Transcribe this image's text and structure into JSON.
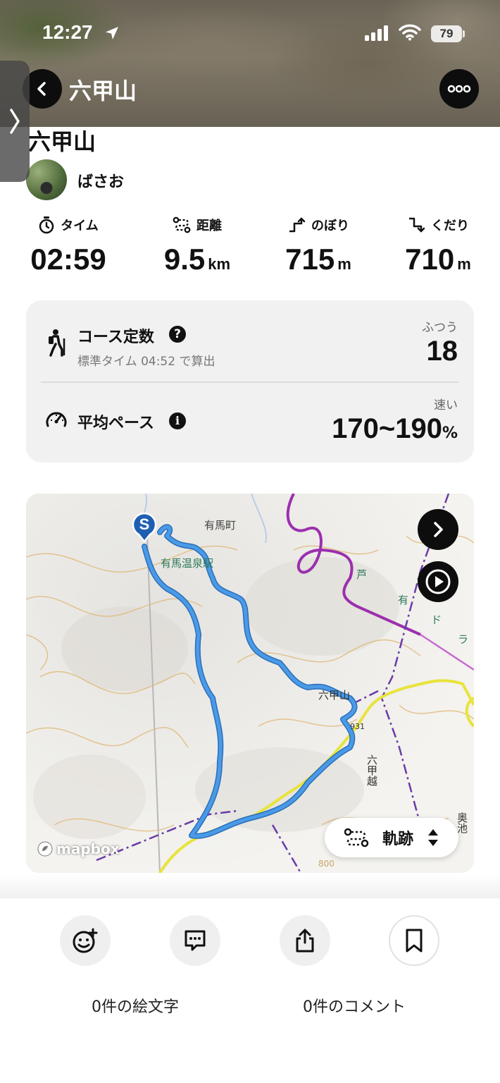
{
  "status_bar": {
    "time": "12:27",
    "battery": "79"
  },
  "nav": {
    "title": "六甲山"
  },
  "activity": {
    "title": "六甲山",
    "user": "ばさお",
    "stats": [
      {
        "label": "タイム",
        "value": "02:59",
        "unit": "",
        "icon": "stopwatch-icon"
      },
      {
        "label": "距離",
        "value": "9.5",
        "unit": "km",
        "icon": "route-icon"
      },
      {
        "label": "のぼり",
        "value": "715",
        "unit": "m",
        "icon": "ascent-icon"
      },
      {
        "label": "くだり",
        "value": "710",
        "unit": "m",
        "icon": "descent-icon"
      }
    ]
  },
  "course_card": {
    "course_constant": {
      "label": "コース定数",
      "sub": "標準タイム 04:52 で算出",
      "rating": "ふつう",
      "value": "18"
    },
    "average_pace": {
      "label": "平均ペース",
      "rating": "速い",
      "value": "170~190",
      "unit": "%"
    }
  },
  "map": {
    "labels": {
      "town": "有馬町",
      "station": "有馬温泉駅",
      "peak": "六甲山",
      "pass": "六甲越",
      "pass_code": "931",
      "elev": "800",
      "pond": "奥池",
      "drive_1": "芦",
      "drive_2": "有",
      "drive_3": "ド",
      "drive_4": "ラ"
    },
    "start_marker": "S",
    "attribution": "mapbox",
    "track_toggle": "軌跡",
    "colors": {
      "track": "#3b8fe0",
      "road_purple": "#9b2fae",
      "road_yellow": "#e8e33a"
    }
  },
  "actions": {
    "emoji_count": "0件の絵文字",
    "comment_count": "0件のコメント"
  }
}
